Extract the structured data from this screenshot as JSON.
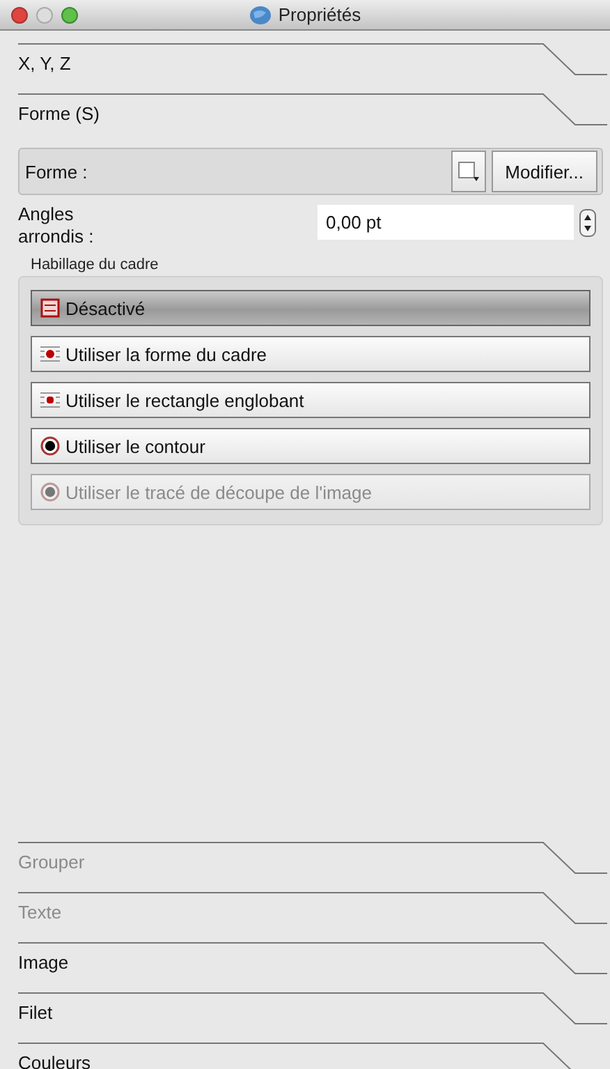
{
  "window": {
    "title": "Propriétés"
  },
  "top_sections": [
    {
      "label": "X, Y, Z",
      "disabled": false
    },
    {
      "label": "Forme (S)",
      "disabled": false
    }
  ],
  "shape": {
    "label": "Forme :",
    "button": "Modifier..."
  },
  "rounded_corners": {
    "label": "Angles arrondis :",
    "value": "0,00 pt"
  },
  "wrap": {
    "title": "Habillage du cadre",
    "options": [
      {
        "kind": "off",
        "label": "Désactivé",
        "selected": true,
        "disabled": false
      },
      {
        "kind": "frame",
        "label": "Utiliser la forme du cadre",
        "selected": false,
        "disabled": false
      },
      {
        "kind": "bounds",
        "label": "Utiliser le rectangle englobant",
        "selected": false,
        "disabled": false
      },
      {
        "kind": "contour",
        "label": "Utiliser le contour",
        "selected": false,
        "disabled": false
      },
      {
        "kind": "clip",
        "label": "Utiliser le tracé de découpe de l'image",
        "selected": false,
        "disabled": true
      }
    ]
  },
  "bottom_sections": [
    {
      "label": "Grouper",
      "disabled": true
    },
    {
      "label": "Texte",
      "disabled": true
    },
    {
      "label": "Image",
      "disabled": false
    },
    {
      "label": "Filet",
      "disabled": false
    },
    {
      "label": "Couleurs",
      "disabled": false
    }
  ]
}
